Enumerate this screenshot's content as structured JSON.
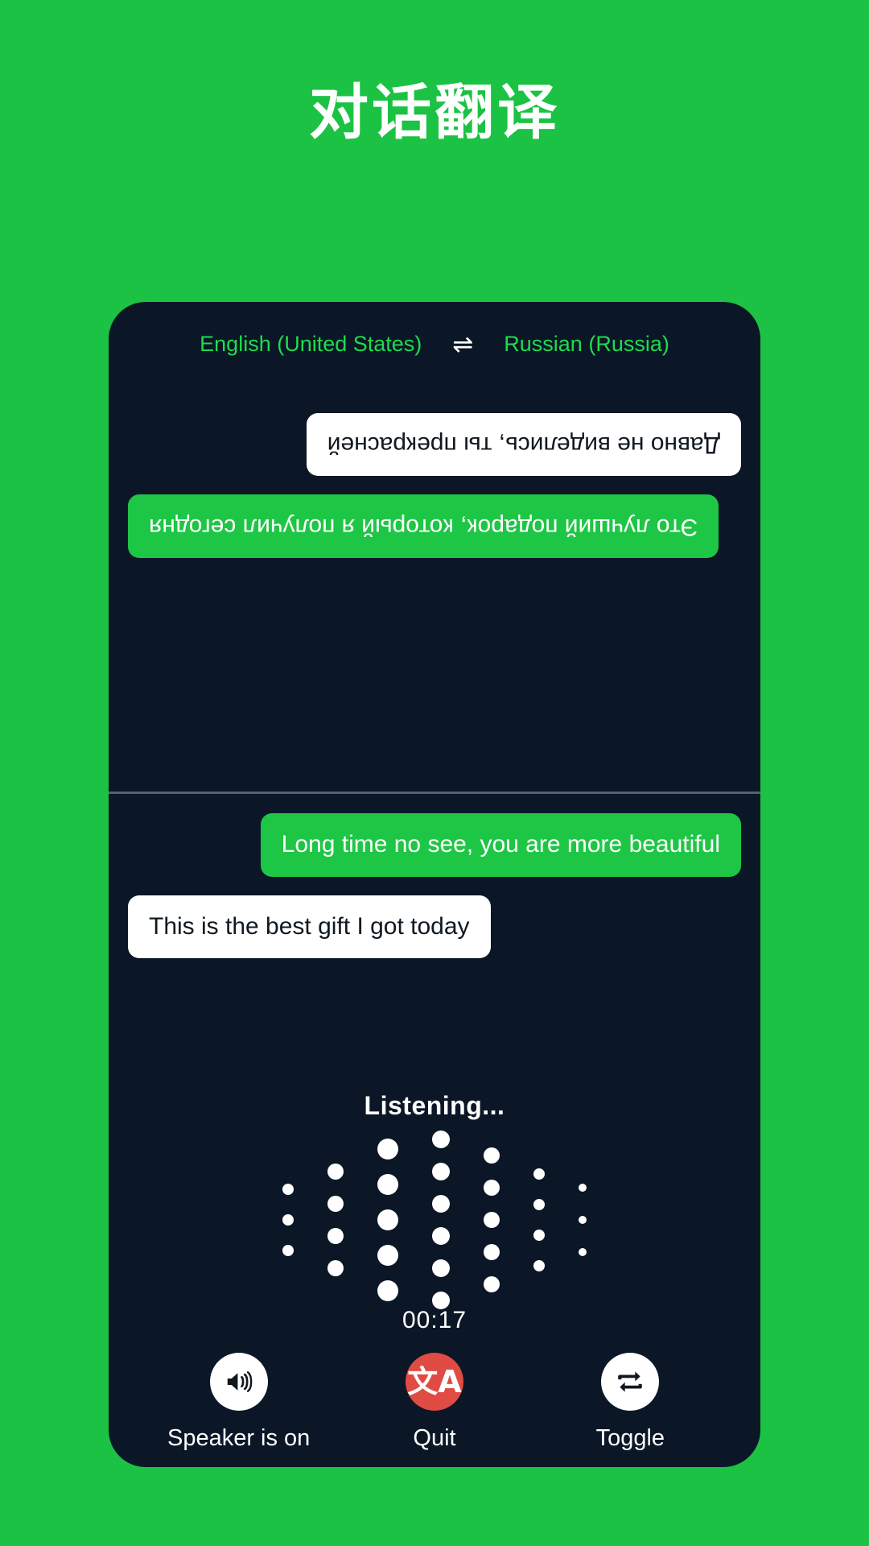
{
  "page": {
    "title": "对话翻译",
    "background_color": "#1bc243"
  },
  "card": {
    "background_color": "#0b1726",
    "accent_green": "#1ec645",
    "lang_text_color": "#1fdb4e",
    "danger_color": "#e04b43"
  },
  "language_bar": {
    "source_language": "English (United States)",
    "swap_icon": "swap-horizontal-icon",
    "swap_glyph": "⇌",
    "target_language": "Russian (Russia)"
  },
  "conversation": {
    "remote_pane": {
      "rotated": "180",
      "messages": [
        {
          "id": "remote-msg-1",
          "text": "Это лучший подарок, который я получил сегодня",
          "style": "green",
          "align": "right"
        },
        {
          "id": "remote-msg-2",
          "text": "Давно не виделись, ты прекрасней",
          "style": "white",
          "align": "left"
        }
      ]
    },
    "local_pane": {
      "messages": [
        {
          "id": "local-msg-1",
          "text": "Long time no see, you are more beautiful",
          "style": "green",
          "align": "right"
        },
        {
          "id": "local-msg-2",
          "text": "This is the best gift I got today",
          "style": "white",
          "align": "left"
        }
      ]
    }
  },
  "recording": {
    "status_text": "Listening...",
    "timer": "00:17",
    "waveform": {
      "type": "dot-columns",
      "color": "#ffffff",
      "columns": [
        {
          "dots": 3,
          "dot_size": 14,
          "gap": 24
        },
        {
          "dots": 4,
          "dot_size": 20,
          "gap": 20
        },
        {
          "dots": 5,
          "dot_size": 26,
          "gap": 18
        },
        {
          "dots": 6,
          "dot_size": 22,
          "gap": 18
        },
        {
          "dots": 5,
          "dot_size": 20,
          "gap": 20
        },
        {
          "dots": 4,
          "dot_size": 14,
          "gap": 24
        },
        {
          "dots": 3,
          "dot_size": 10,
          "gap": 30
        }
      ]
    }
  },
  "controls": [
    {
      "id": "speaker-button",
      "label": "Speaker is on",
      "icon": "speaker-on-icon",
      "circle_style": "light"
    },
    {
      "id": "quit-button",
      "label": "Quit",
      "icon": "translate-icon",
      "glyph": "文A",
      "circle_style": "danger"
    },
    {
      "id": "toggle-button",
      "label": "Toggle",
      "icon": "swap-repeat-icon",
      "circle_style": "light"
    }
  ]
}
